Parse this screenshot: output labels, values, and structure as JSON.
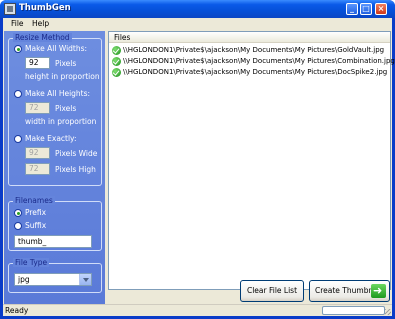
{
  "window": {
    "title": "ThumbGen"
  },
  "menu": {
    "items": [
      "File",
      "Help"
    ]
  },
  "resize_method": {
    "title": "Resize Method",
    "options": [
      {
        "label": "Make All Widths:",
        "value": "92",
        "unit": "Pixels",
        "note": "height in proportion",
        "checked": true
      },
      {
        "label": "Make All Heights:",
        "value": "72",
        "unit": "Pixels",
        "note": "width in proportion",
        "checked": false
      },
      {
        "label": "Make Exactly:",
        "width_value": "92",
        "width_unit": "Pixels Wide",
        "height_value": "72",
        "height_unit": "Pixels High",
        "checked": false
      }
    ]
  },
  "filenames": {
    "title": "Filenames",
    "prefix_label": "Prefix",
    "suffix_label": "Suffix",
    "selected": "Prefix",
    "value": "thumb_"
  },
  "file_type": {
    "title": "File Type",
    "selected": "jpg"
  },
  "file_list": {
    "header": "Files",
    "rows": [
      "\\\\HGLONDON1\\Private$\\ajackson\\My Documents\\My Pictures\\GoldVault.jpg",
      "\\\\HGLONDON1\\Private$\\ajackson\\My Documents\\My Pictures\\Combination.jpg",
      "\\\\HGLONDON1\\Private$\\ajackson\\My Documents\\My Pictures\\DocSpike2.jpg"
    ]
  },
  "buttons": {
    "clear": "Clear File List",
    "create": "Create Thumbnails"
  },
  "status": {
    "text": "Ready"
  }
}
